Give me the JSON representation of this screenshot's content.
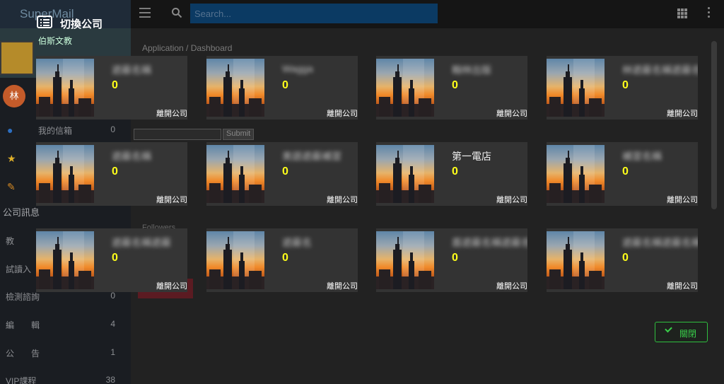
{
  "app": {
    "brand": "SuperMail",
    "user_name": "伯斯文教",
    "avatar_letter": "林"
  },
  "sidebar": {
    "items": [
      {
        "label": "我的信箱",
        "count": "0"
      },
      {
        "label": "教",
        "count": ""
      },
      {
        "label": "試讀入",
        "count": ""
      },
      {
        "label": "檢測諮詢",
        "count": "0"
      },
      {
        "label": "編　　輯",
        "count": "4"
      },
      {
        "label": "公　　告",
        "count": "1"
      },
      {
        "label": "VIP課程",
        "count": "38"
      }
    ],
    "section": "公司訊息"
  },
  "topbar": {
    "search_placeholder": "Search..."
  },
  "main": {
    "breadcrumb": "Application / Dashboard",
    "ghost_submit": "Submit",
    "ghost_followers": "Followers"
  },
  "modal": {
    "title": "切換公司",
    "close_label": "關閉",
    "leave_label": "離開公司",
    "companies": [
      {
        "name": "遮蔽名稱",
        "count": "0",
        "blurred": true
      },
      {
        "name": "Wagga",
        "count": "0",
        "blurred": true
      },
      {
        "name": "翰林出版",
        "count": "0",
        "blurred": true
      },
      {
        "name": "林遮蔽名稱遮蔽名稱...",
        "count": "0",
        "blurred": true
      },
      {
        "name": "遮蔽名稱",
        "count": "0",
        "blurred": true
      },
      {
        "name": "美語遮蔽補習",
        "count": "0",
        "blurred": true
      },
      {
        "name": "第一電店",
        "count": "0",
        "blurred": false
      },
      {
        "name": "補習名稱",
        "count": "0",
        "blurred": true
      },
      {
        "name": "遮蔽名稱遮蔽",
        "count": "0",
        "blurred": true
      },
      {
        "name": "遮蔽名",
        "count": "0",
        "blurred": true
      },
      {
        "name": "盾遮蔽名稱遮蔽名稱.",
        "count": "0",
        "blurred": true
      },
      {
        "name": "遮蔽名稱遮蔽名稱N",
        "count": "0",
        "blurred": true
      }
    ]
  }
}
